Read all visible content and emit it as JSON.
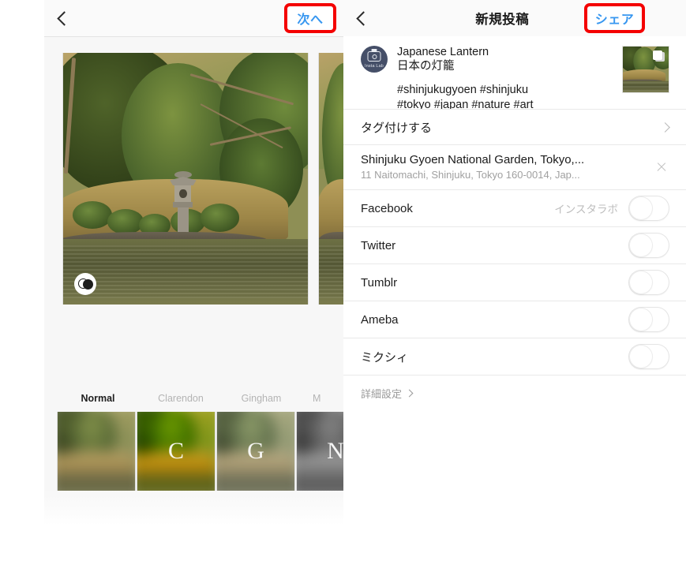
{
  "left_screen": {
    "nav": {
      "back_icon": "chevron-left-icon",
      "next_label": "次へ"
    },
    "photo": {
      "adjust_icon": "filter-adjust-icon",
      "alt": "Japanese garden with stone lantern beside a pond"
    },
    "filters": {
      "items": [
        {
          "name": "Normal",
          "letter": "",
          "active": true
        },
        {
          "name": "Clarendon",
          "letter": "C",
          "active": false
        },
        {
          "name": "Gingham",
          "letter": "G",
          "active": false
        },
        {
          "name": "M",
          "letter": "N",
          "active": false
        }
      ]
    }
  },
  "right_screen": {
    "nav": {
      "back_icon": "chevron-left-icon",
      "title": "新規投稿",
      "share_label": "シェア"
    },
    "caption": {
      "avatar_label": "Insta Lab",
      "avatar_icon": "camera-icon",
      "title": "Japanese Lantern",
      "subtitle": "日本の灯籠",
      "tags_line1": "#shinjukugyoen #shinjuku",
      "tags_line2": "#tokyo #japan #nature #art",
      "thumb_icon": "multi-photo-icon"
    },
    "tag_row": {
      "label": "タグ付けする",
      "chevron_icon": "chevron-right-icon"
    },
    "location_row": {
      "name": "Shinjuku Gyoen National Garden, Tokyo,...",
      "address": "11 Naitomachi, Shinjuku, Tokyo 160-0014, Jap...",
      "clear_icon": "close-icon"
    },
    "social": [
      {
        "label": "Facebook",
        "note": "インスタラボ",
        "on": false
      },
      {
        "label": "Twitter",
        "note": "",
        "on": false
      },
      {
        "label": "Tumblr",
        "note": "",
        "on": false
      },
      {
        "label": "Ameba",
        "note": "",
        "on": false
      },
      {
        "label": "ミクシィ",
        "note": "",
        "on": false
      }
    ],
    "advanced": {
      "label": "詳細設定",
      "chevron_icon": "chevron-right-icon"
    }
  },
  "annotations": {
    "color": "#f40000",
    "targets": [
      "次へ",
      "シェア"
    ]
  }
}
